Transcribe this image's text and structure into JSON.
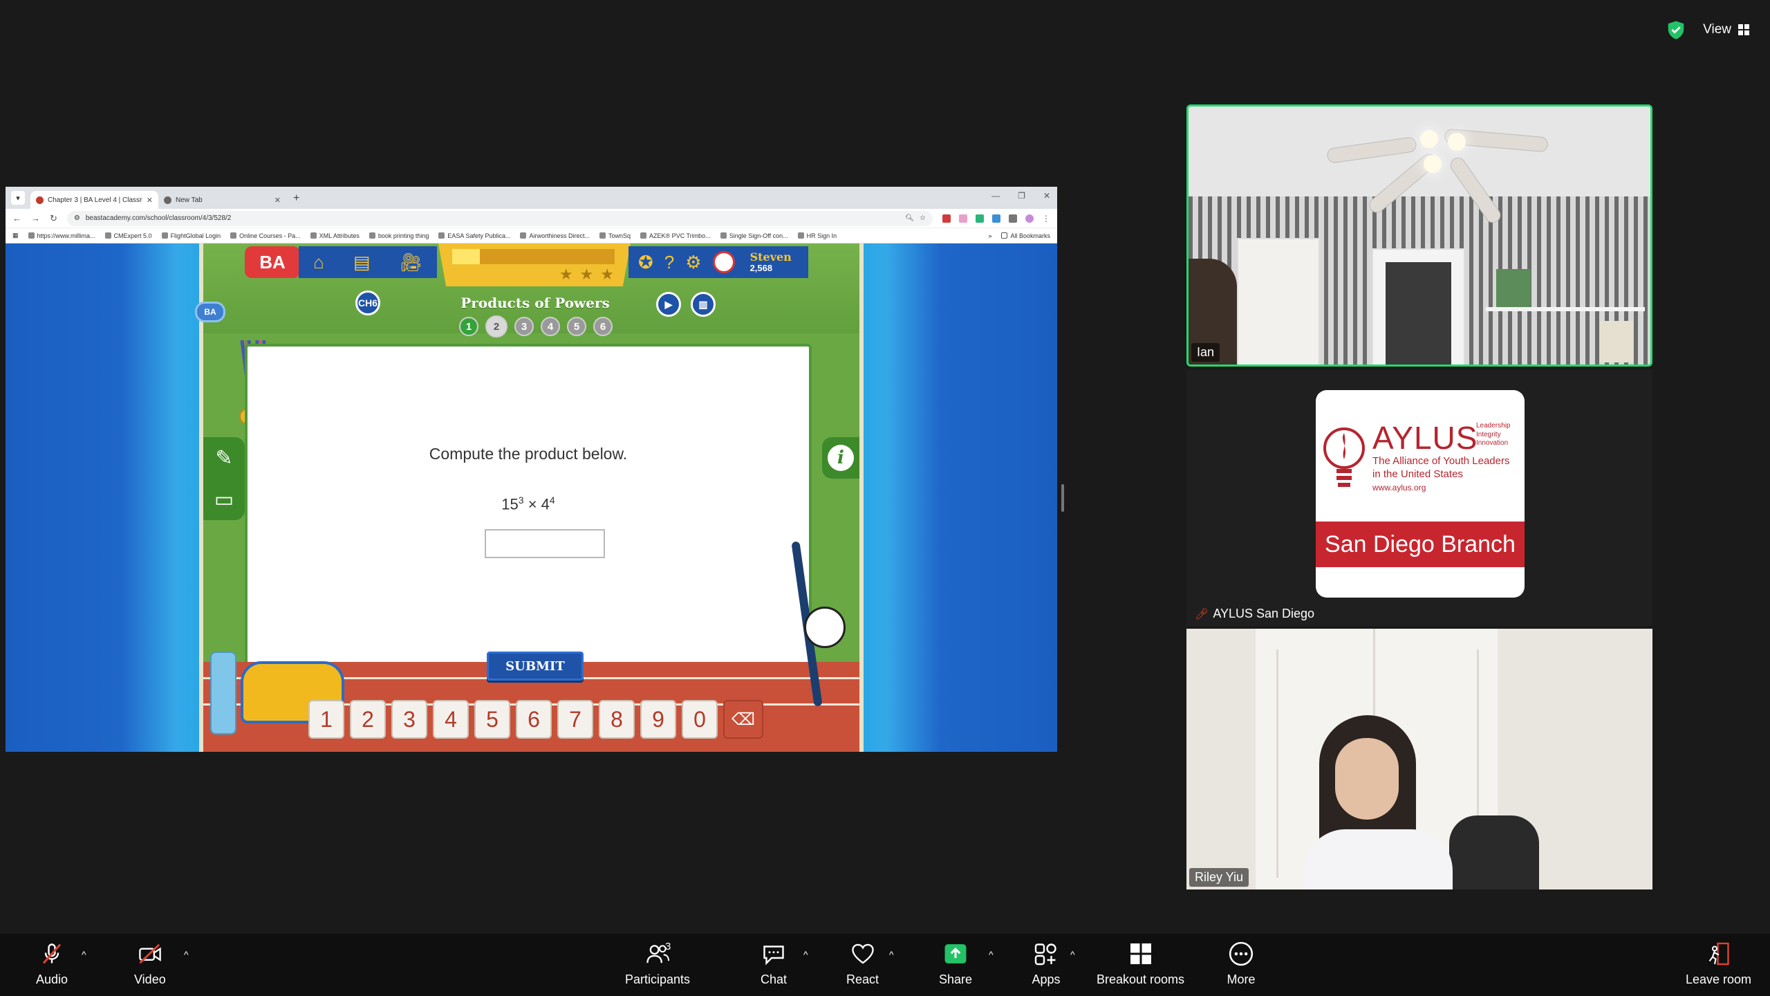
{
  "window": {
    "view_label": "View"
  },
  "browser": {
    "tabs": [
      {
        "title": "Chapter 3 | BA Level 4 | Classro"
      },
      {
        "title": "New Tab"
      }
    ],
    "url": "beastacademy.com/school/classroom/4/3/528/2",
    "bookmarks": [
      "https://www.millima...",
      "CMExpert 5.0",
      "FlightGlobal Login",
      "Online Courses - Pa...",
      "XML Attributes",
      "book printing thing",
      "EASA Safety Publica...",
      "Airworthiness Direct...",
      "TownSq",
      "AZEK® PVC Trimbo...",
      "Single Sign-Off con...",
      "HR Sign In"
    ],
    "all_bookmarks": "All Bookmarks"
  },
  "game": {
    "logo": "BA",
    "user_name": "Steven",
    "coins": "2,568",
    "ch_badge": "CH6",
    "lesson_title": "Products of Powers",
    "question": "Compute the product below.",
    "base1": "15",
    "exp1": "3",
    "times": "×",
    "base2": "4",
    "exp2": "4",
    "answer_value": "",
    "submit_label": "SUBMIT",
    "progress_dots": [
      "1",
      "2",
      "3",
      "4",
      "5",
      "6"
    ],
    "current_problem": 2,
    "keys": [
      "1",
      "2",
      "3",
      "4",
      "5",
      "6",
      "7",
      "8",
      "9",
      "0"
    ],
    "delete_key": "⌫"
  },
  "participants": [
    {
      "name": "Ian",
      "active_speaker": true,
      "muted": false
    },
    {
      "name": "AYLUS San Diego",
      "muted": true
    },
    {
      "name": "Riley Yiu",
      "muted": false
    }
  ],
  "aylus_logo": {
    "word": "AYLUS",
    "tags": [
      "Leadership",
      "Integrity",
      "Innovation"
    ],
    "sub": [
      "The Alliance of Youth Leaders",
      "in the United States"
    ],
    "site": "www.aylus.org",
    "band": "San Diego Branch",
    "color": "#c8262f"
  },
  "toolbar": {
    "audio": "Audio",
    "video": "Video",
    "participants": "Participants",
    "participants_count": "3",
    "chat": "Chat",
    "react": "React",
    "share": "Share",
    "apps": "Apps",
    "breakout": "Breakout rooms",
    "more": "More",
    "leave": "Leave room"
  }
}
